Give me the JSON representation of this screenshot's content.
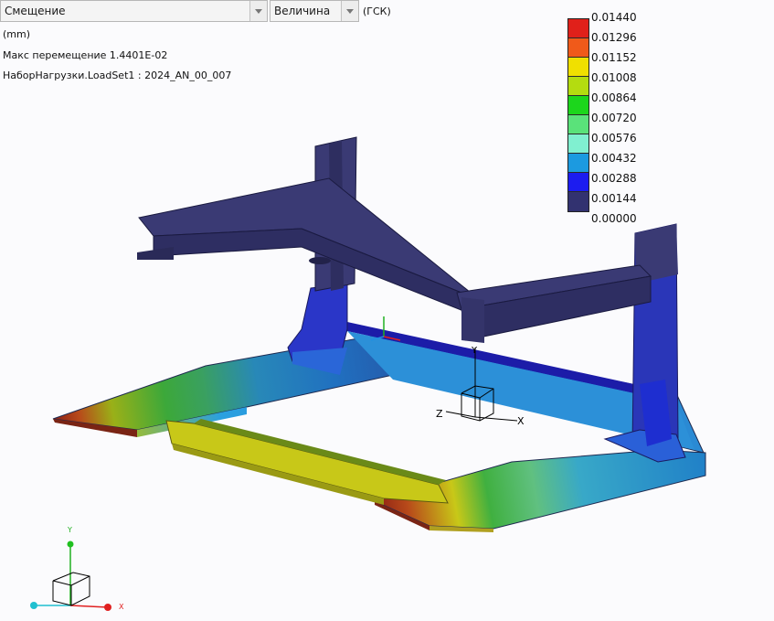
{
  "toolbar": {
    "result_select": "Смещение",
    "component_select": "Величина",
    "coord_system": "(ГСК)"
  },
  "info": {
    "units": "(mm)",
    "max_displacement": "Макс перемещение  1.4401E-02",
    "load_set": "НаборНагрузки.LoadSet1 :  2024_AN_00_007"
  },
  "legend": {
    "colors": [
      "#e0201a",
      "#f05a1a",
      "#f0e000",
      "#b4dc10",
      "#1cd61c",
      "#5ae27a",
      "#80f0d0",
      "#1c9ae0",
      "#1c1cf0",
      "#323270"
    ],
    "labels": [
      "0.01440",
      "0.01296",
      "0.01152",
      "0.01008",
      "0.00864",
      "0.00720",
      "0.00576",
      "0.00432",
      "0.00288",
      "0.00144",
      "0.00000"
    ]
  },
  "model_triad": {
    "x": "X",
    "y": "Y",
    "z": "Z"
  },
  "view_triad": {
    "x": "X",
    "y": "Y"
  }
}
